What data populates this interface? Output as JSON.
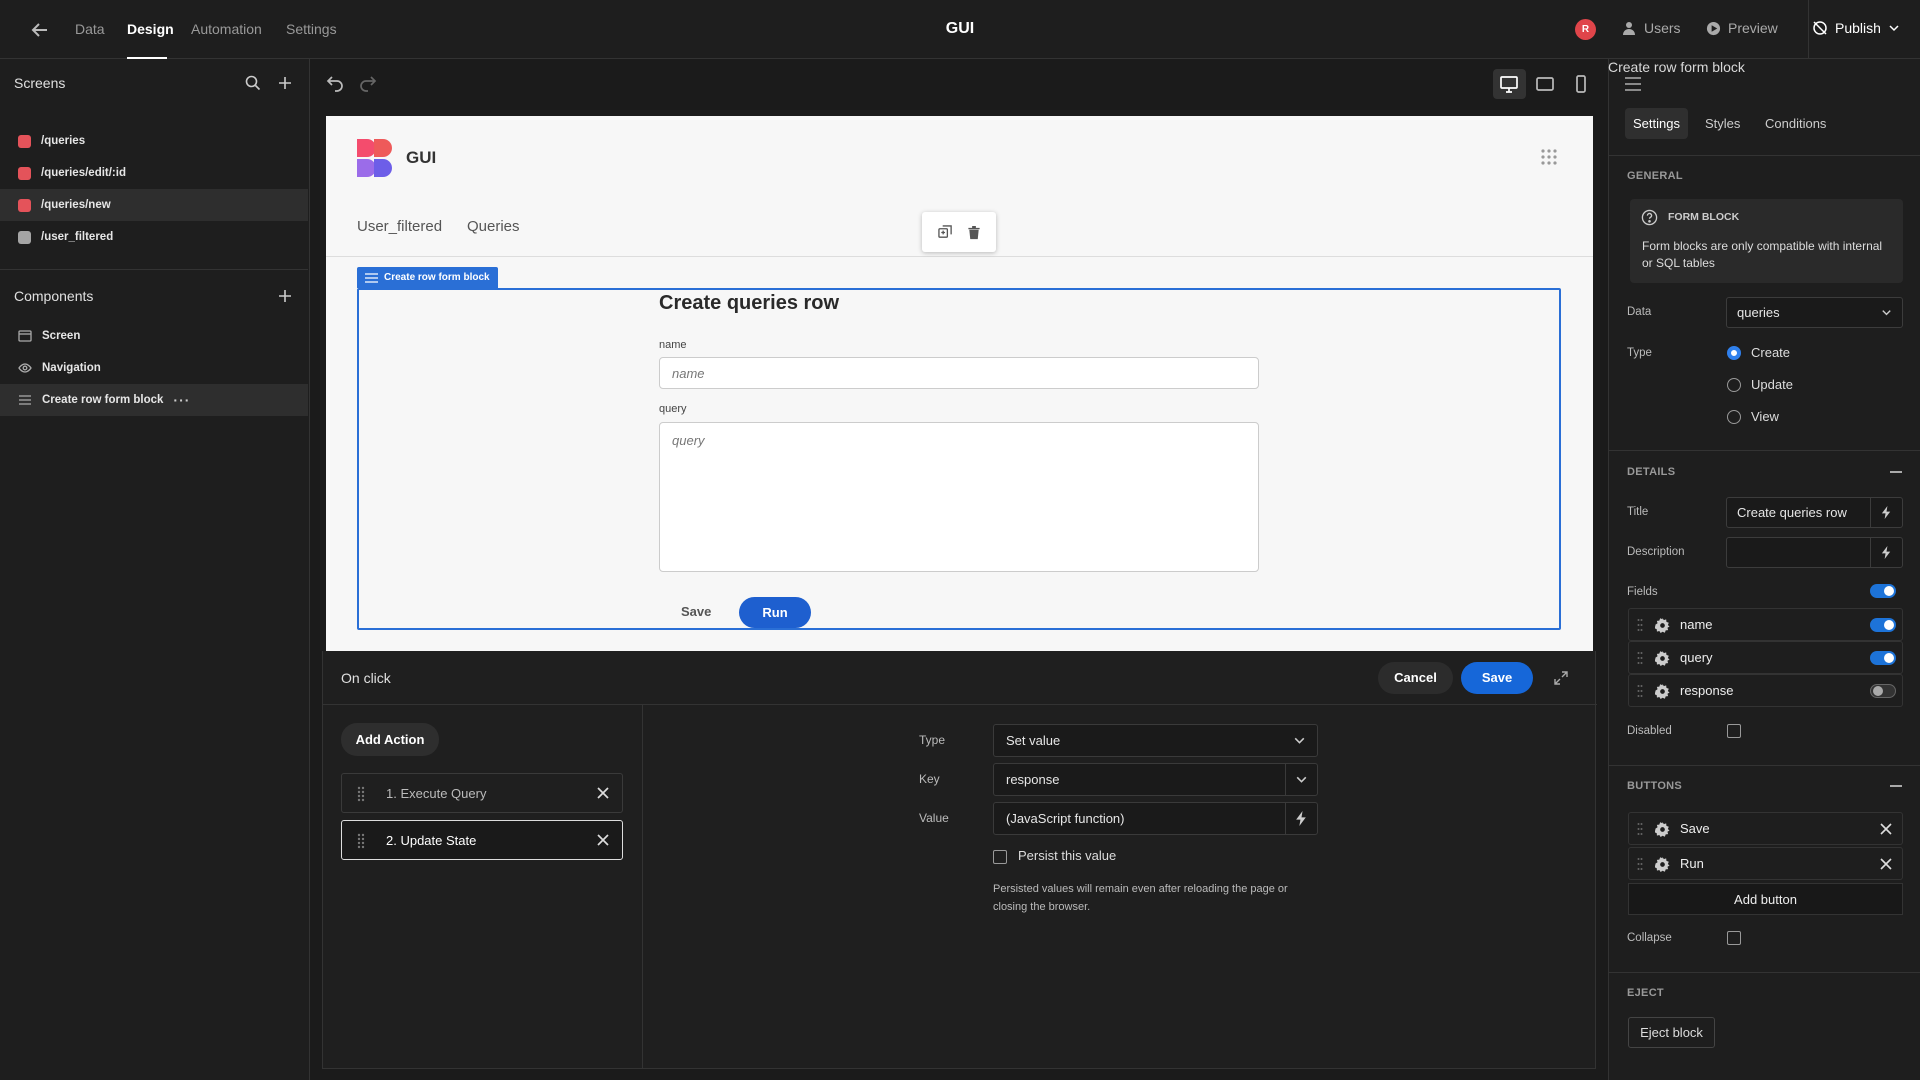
{
  "topbar": {
    "tabs": [
      "Data",
      "Design",
      "Automation",
      "Settings"
    ],
    "active_tab": "Design",
    "app_title": "GUI",
    "avatar_letter": "R",
    "users_label": "Users",
    "preview_label": "Preview",
    "publish_label": "Publish"
  },
  "sidebar": {
    "screens_header": "Screens",
    "screens": [
      {
        "route": "/queries",
        "color": "#e4535a"
      },
      {
        "route": "/queries/edit/:id",
        "color": "#e4535a"
      },
      {
        "route": "/queries/new",
        "color": "#e4535a",
        "selected": true
      },
      {
        "route": "/user_filtered",
        "color": "#a5a5a5"
      }
    ],
    "components_header": "Components",
    "components": [
      {
        "label": "Screen",
        "icon": "screen-icon"
      },
      {
        "label": "Navigation",
        "icon": "eye-icon"
      },
      {
        "label": "Create row form block",
        "icon": "form-icon",
        "selected": true
      }
    ]
  },
  "preview": {
    "app_name": "GUI",
    "nav_links": [
      "User_filtered",
      "Queries"
    ],
    "block_label": "Create row form block",
    "form_title": "Create queries row",
    "fields": [
      {
        "label": "name",
        "placeholder": "name"
      },
      {
        "label": "query",
        "placeholder": "query"
      }
    ],
    "save_label": "Save",
    "run_label": "Run"
  },
  "drawer": {
    "title": "On click",
    "cancel_label": "Cancel",
    "save_label": "Save",
    "add_action_label": "Add Action",
    "actions": [
      "1. Execute Query",
      "2. Update State"
    ],
    "selected_action": 1,
    "type_label": "Type",
    "type_value": "Set value",
    "key_label": "Key",
    "key_value": "response",
    "value_label": "Value",
    "value_value": "(JavaScript function)",
    "persist_label": "Persist this value",
    "persist_note": "Persisted values will remain even after reloading the page or closing the browser."
  },
  "panel": {
    "header": "Create row form block",
    "tabs": [
      "Settings",
      "Styles",
      "Conditions"
    ],
    "active_tab": "Settings",
    "general_header": "GENERAL",
    "info_title": "FORM BLOCK",
    "info_text": "Form blocks are only compatible with internal or SQL tables",
    "data_label": "Data",
    "data_value": "queries",
    "type_label": "Type",
    "type_options": [
      "Create",
      "Update",
      "View"
    ],
    "type_selected": "Create",
    "details_header": "DETAILS",
    "title_label": "Title",
    "title_value": "Create queries row",
    "description_label": "Description",
    "description_value": "",
    "fields_label": "Fields",
    "fields": [
      {
        "name": "name",
        "enabled": true
      },
      {
        "name": "query",
        "enabled": true
      },
      {
        "name": "response",
        "enabled": false
      }
    ],
    "disabled_label": "Disabled",
    "buttons_header": "BUTTONS",
    "buttons": [
      "Save",
      "Run"
    ],
    "add_button_label": "Add button",
    "collapse_label": "Collapse",
    "eject_header": "EJECT",
    "eject_label": "Eject block"
  },
  "colors": {
    "accent": "#1667d9",
    "form_outline": "#2a6fd6",
    "screen_red": "#e4535a"
  }
}
